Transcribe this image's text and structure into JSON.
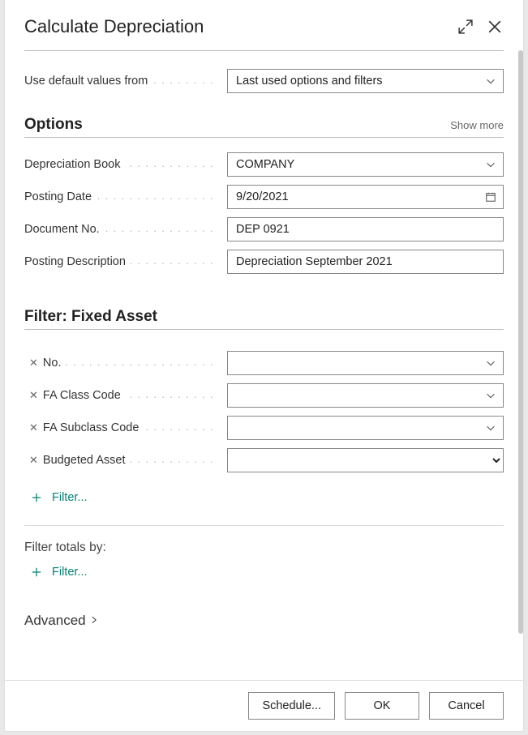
{
  "header": {
    "title": "Calculate Depreciation"
  },
  "defaults": {
    "label": "Use default values from",
    "value": "Last used options and filters"
  },
  "options": {
    "heading": "Options",
    "show_more": "Show more",
    "fields": {
      "depreciation_book": {
        "label": "Depreciation Book",
        "value": "COMPANY"
      },
      "posting_date": {
        "label": "Posting Date",
        "value": "9/20/2021"
      },
      "document_no": {
        "label": "Document No.",
        "value": "DEP 0921"
      },
      "posting_description": {
        "label": "Posting Description",
        "value": "Depreciation September 2021"
      }
    }
  },
  "filter_fa": {
    "heading": "Filter: Fixed Asset",
    "rows": [
      {
        "label": "No.",
        "value": ""
      },
      {
        "label": "FA Class Code",
        "value": ""
      },
      {
        "label": "FA Subclass Code",
        "value": ""
      },
      {
        "label": "Budgeted Asset",
        "value": ""
      }
    ],
    "add_label": "Filter..."
  },
  "filter_totals": {
    "heading": "Filter totals by:",
    "add_label": "Filter..."
  },
  "advanced": {
    "heading": "Advanced"
  },
  "footer": {
    "schedule": "Schedule...",
    "ok": "OK",
    "cancel": "Cancel"
  }
}
